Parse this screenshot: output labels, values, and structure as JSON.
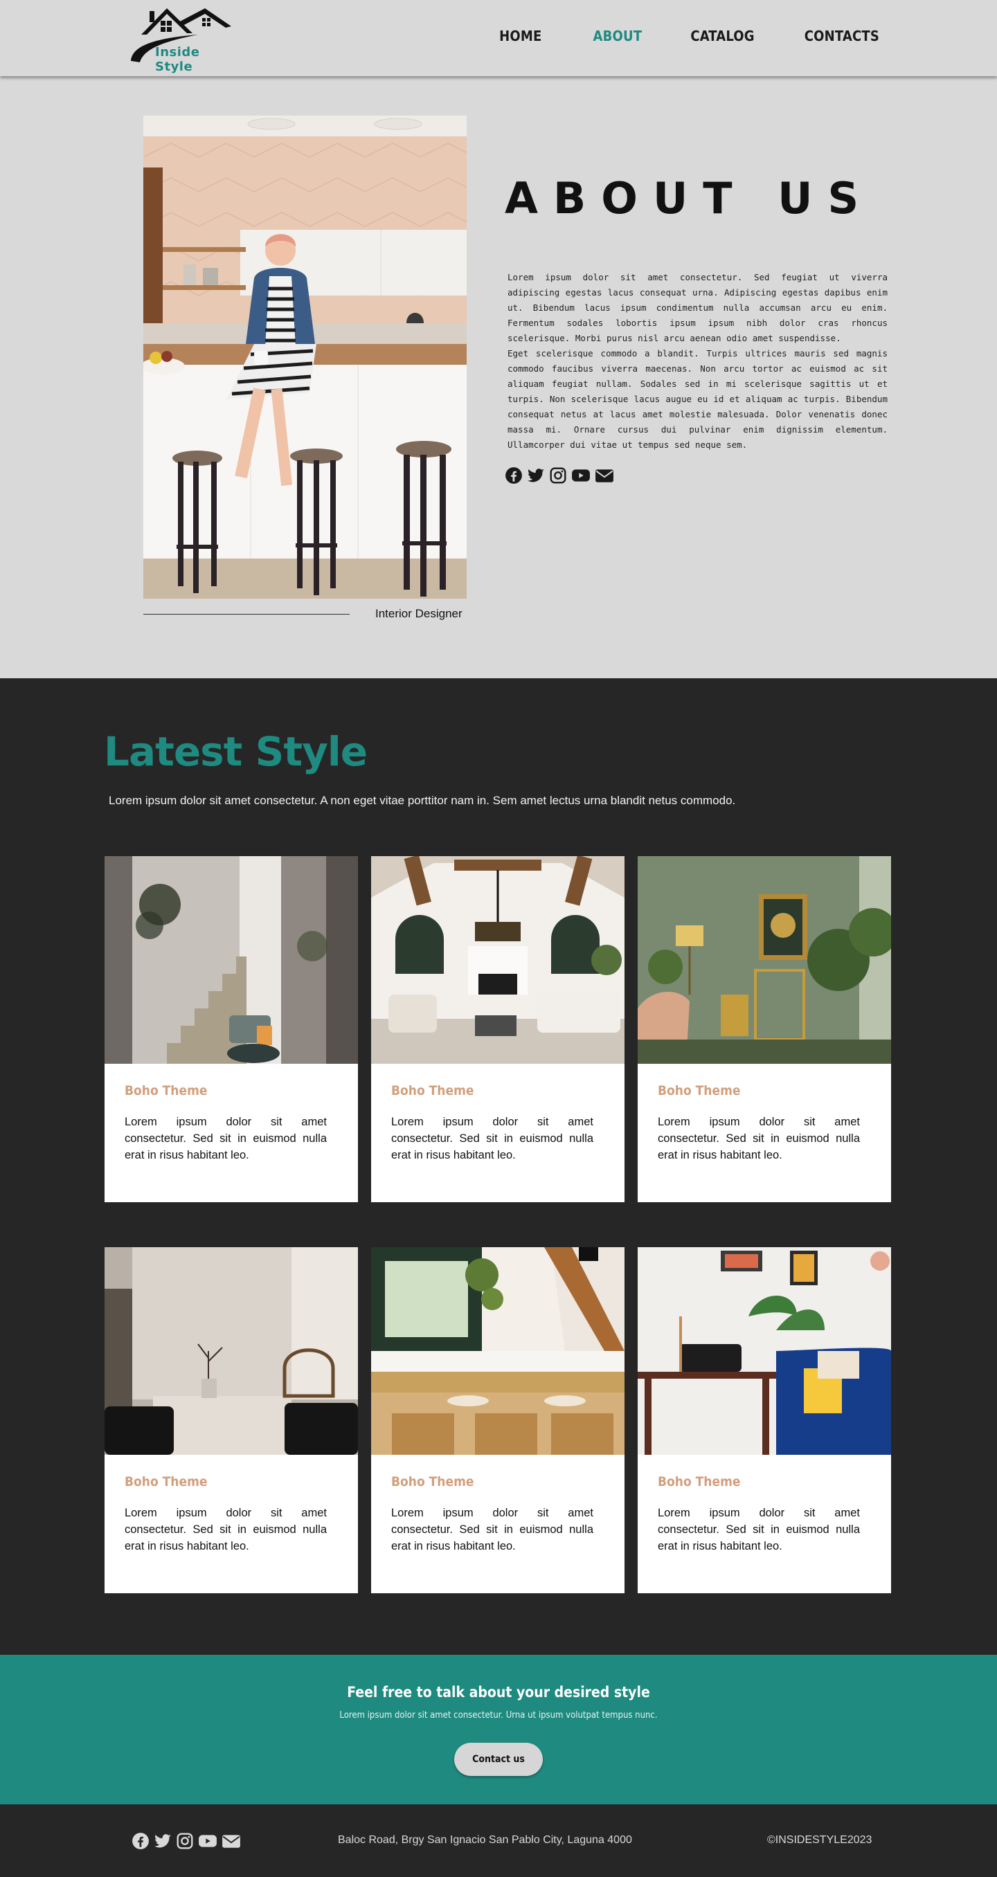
{
  "brand": {
    "name": "Inside Style"
  },
  "nav": {
    "items": [
      {
        "label": "HOME",
        "active": false
      },
      {
        "label": "ABOUT",
        "active": true
      },
      {
        "label": "CATALOG",
        "active": false
      },
      {
        "label": "CONTACTS",
        "active": false
      }
    ]
  },
  "about": {
    "title": "ABOUT US",
    "paragraph1": "Lorem ipsum dolor sit amet consectetur. Sed feugiat ut viverra adipiscing egestas lacus consequat urna. Adipiscing egestas dapibus enim ut. Bibendum lacus ipsum condimentum nulla accumsan arcu eu enim. Fermentum sodales lobortis ipsum ipsum nibh dolor cras rhoncus scelerisque. Morbi purus nisl arcu aenean odio amet suspendisse.",
    "paragraph2": "Eget scelerisque commodo a blandit. Turpis ultrices mauris sed magnis commodo faucibus viverra maecenas. Non arcu tortor ac euismod ac sit aliquam feugiat nullam. Sodales sed in mi scelerisque sagittis ut et turpis. Non scelerisque lacus augue eu id et aliquam ac turpis. Bibendum consequat netus at lacus amet molestie malesuada. Dolor venenatis donec massa mi. Ornare cursus dui pulvinar enim dignissim elementum. Ullamcorper dui vitae ut tempus sed neque sem.",
    "caption": "Interior Designer",
    "social_icons": [
      "facebook-icon",
      "twitter-icon",
      "instagram-icon",
      "youtube-icon",
      "email-icon"
    ]
  },
  "latest": {
    "title": "Latest Style",
    "description": "Lorem ipsum dolor sit amet consectetur. A non eget vitae porttitor nam in. Sem amet lectus urna blandit netus commodo.",
    "cards": [
      {
        "title": "Boho Theme",
        "text": "Lorem ipsum dolor sit amet consectetur. Sed sit in euismod nulla erat in risus habitant leo."
      },
      {
        "title": "Boho Theme",
        "text": "Lorem ipsum dolor sit amet consectetur. Sed sit in euismod nulla erat in risus habitant leo."
      },
      {
        "title": "Boho Theme",
        "text": "Lorem ipsum dolor sit amet consectetur. Sed sit in euismod nulla erat in risus habitant leo."
      },
      {
        "title": "Boho Theme",
        "text": "Lorem ipsum dolor sit amet consectetur. Sed sit in euismod nulla erat in risus habitant leo."
      },
      {
        "title": "Boho Theme",
        "text": "Lorem ipsum dolor sit amet consectetur. Sed sit in euismod nulla erat in risus habitant leo."
      },
      {
        "title": "Boho Theme",
        "text": "Lorem ipsum dolor sit amet consectetur. Sed sit in euismod nulla erat in risus habitant leo."
      }
    ]
  },
  "cta": {
    "title": "Feel free to talk about your desired style",
    "text": "Lorem ipsum dolor sit amet consectetur. Urna ut ipsum volutpat tempus nunc.",
    "button_label": "Contact us"
  },
  "footer": {
    "address": "Baloc Road, Brgy San Ignacio San Pablo City, Laguna 4000",
    "copyright": "©INSIDESTYLE2023",
    "social_icons": [
      "facebook-icon",
      "twitter-icon",
      "instagram-icon",
      "youtube-icon",
      "email-icon"
    ]
  },
  "colors": {
    "accent": "#1e8a80",
    "card_title": "#d19f7d",
    "light_bg": "#d9d9d9",
    "dark_bg": "#262626"
  }
}
